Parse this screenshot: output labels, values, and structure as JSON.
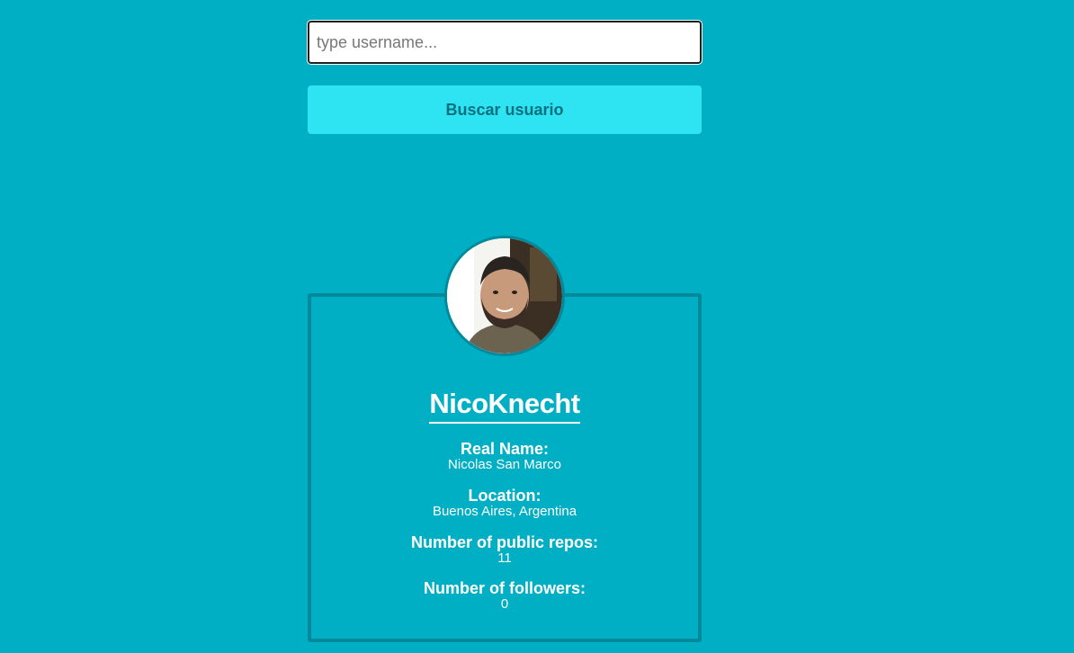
{
  "search": {
    "placeholder": "type username...",
    "value": "",
    "button_label": "Buscar usuario"
  },
  "profile": {
    "username": "NicoKnecht",
    "avatar_icon": "user-avatar-photo",
    "fields": [
      {
        "label": "Real Name:",
        "value": "Nicolas San Marco"
      },
      {
        "label": "Location:",
        "value": "Buenos Aires, Argentina"
      },
      {
        "label": "Number of public repos:",
        "value": "11"
      },
      {
        "label": "Number of followers:",
        "value": "0"
      }
    ]
  },
  "colors": {
    "background": "#00afc3",
    "button": "#2ee4f2",
    "button_text": "#0a7080",
    "card_border": "#00899a"
  }
}
